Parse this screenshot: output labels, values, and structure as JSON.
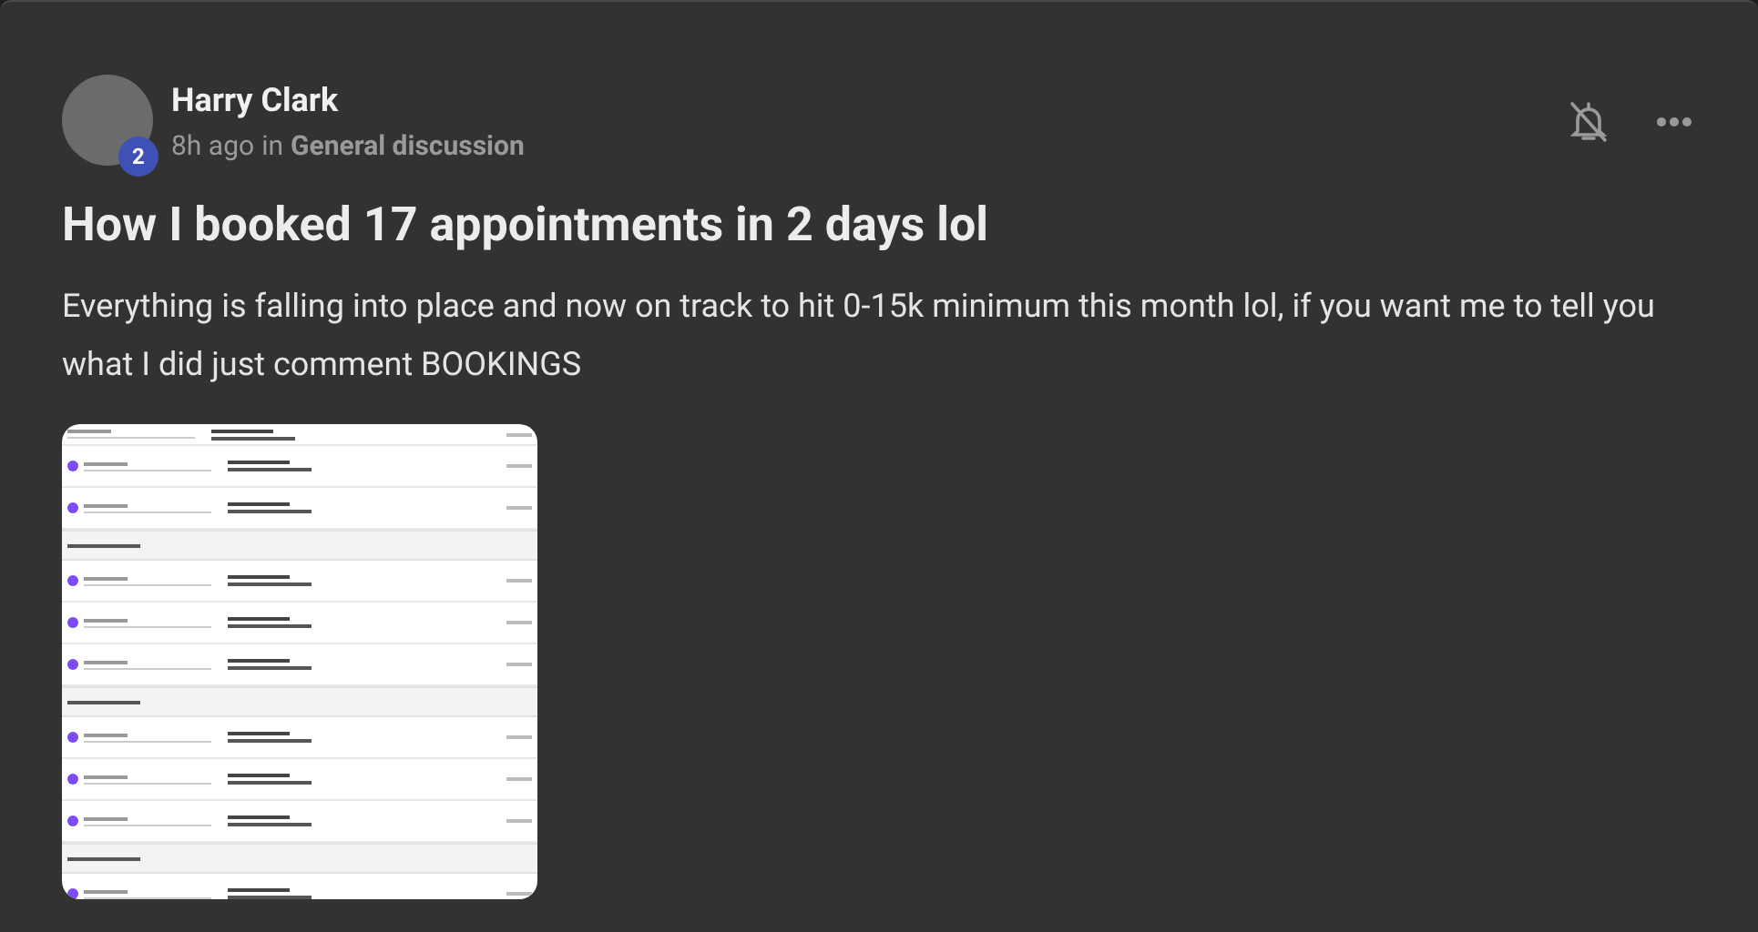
{
  "post": {
    "author": {
      "name": "Harry Clark",
      "level_badge": "2"
    },
    "meta": {
      "time": "8h ago",
      "connector": "in",
      "category": "General discussion"
    },
    "title": "How I booked 17 appointments in 2 days lol",
    "body": "Everything is falling into place and now on track to hit 0-15k minimum this month lol, if you want me to tell you what I did just comment BOOKINGS"
  }
}
